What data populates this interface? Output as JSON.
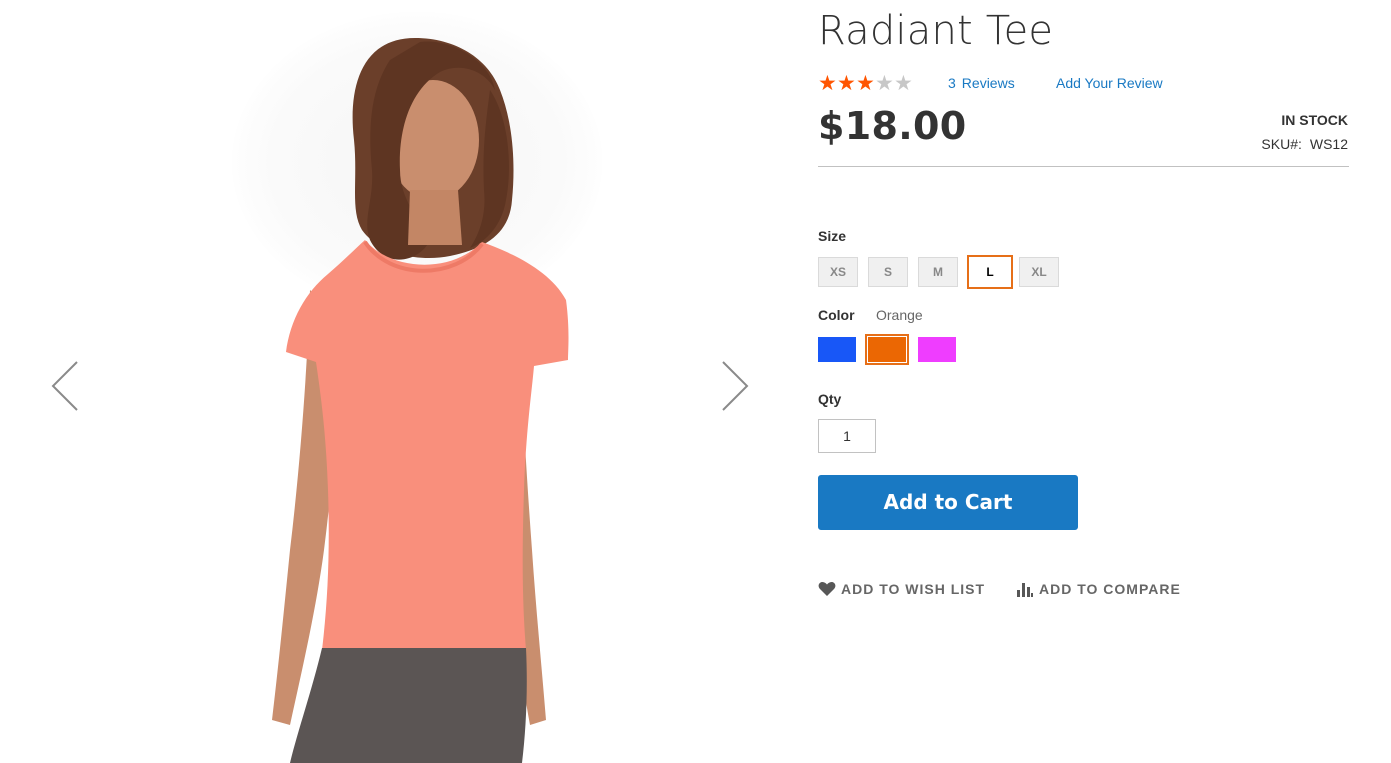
{
  "product": {
    "name": "Radiant Tee",
    "rating": {
      "stars_filled": 3,
      "stars_total": 5
    },
    "reviews_count": "3",
    "reviews_label": "Reviews",
    "add_review_label": "Add Your Review",
    "price": "$18.00",
    "stock_status": "IN STOCK",
    "sku_label": "SKU#:",
    "sku_value": "WS12"
  },
  "options": {
    "size_label": "Size",
    "sizes": [
      "XS",
      "S",
      "M",
      "L",
      "XL"
    ],
    "selected_size": "L",
    "color_label": "Color",
    "selected_color": "Orange",
    "colors": [
      {
        "name": "Blue",
        "hex": "#1857f7"
      },
      {
        "name": "Orange",
        "hex": "#eb6703"
      },
      {
        "name": "Purple",
        "hex": "#ef3dff"
      }
    ]
  },
  "qty": {
    "label": "Qty",
    "value": "1"
  },
  "actions": {
    "add_to_cart": "Add to Cart",
    "wishlist": "ADD TO WISH LIST",
    "compare": "ADD TO COMPARE"
  },
  "gallery": {
    "prev_icon": "chevron-left-icon",
    "next_icon": "chevron-right-icon"
  },
  "colors": {
    "accent": "#1979c3",
    "star_on": "#ff5501",
    "star_off": "#c7c7c7",
    "selected_border": "#e66f18",
    "shirt": "#f98f7c"
  }
}
